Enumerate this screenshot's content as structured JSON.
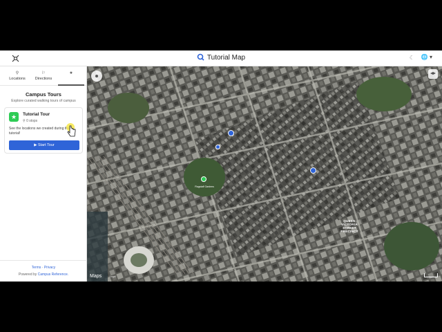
{
  "header": {
    "title": "Tutorial Map",
    "icons": {
      "menu": "menu-grid-icon",
      "logo": "map-logo-icon",
      "theme": "moon-icon",
      "language": "globe-icon"
    }
  },
  "sidebar": {
    "tabs": [
      {
        "label": "Locations",
        "icon": "pin-icon"
      },
      {
        "label": "Directions",
        "icon": "directions-icon"
      },
      {
        "label": "",
        "icon": "tours-icon",
        "active": true
      }
    ],
    "panel": {
      "title": "Campus Tours",
      "subtitle": "Explore curated walking tours of campus"
    },
    "tour": {
      "name": "Tutorial Tour",
      "stops": "0 stops",
      "description": "See the locations we created during the tutorial!",
      "start_label": "Start Tour",
      "badge_color": "#2ecc55"
    },
    "footer": {
      "terms": "Terms",
      "separator": "·",
      "privacy": "Privacy",
      "powered_prefix": "Powered by",
      "powered_link": "Campus Reference."
    }
  },
  "map": {
    "attribution": "Maps",
    "legal": "Legal",
    "labels": {
      "flagstaff": "Flagstaff Gardens",
      "precinct": "QUEEN VICTORIA STREET PRECINCT"
    },
    "accent": "#2f64d8"
  }
}
